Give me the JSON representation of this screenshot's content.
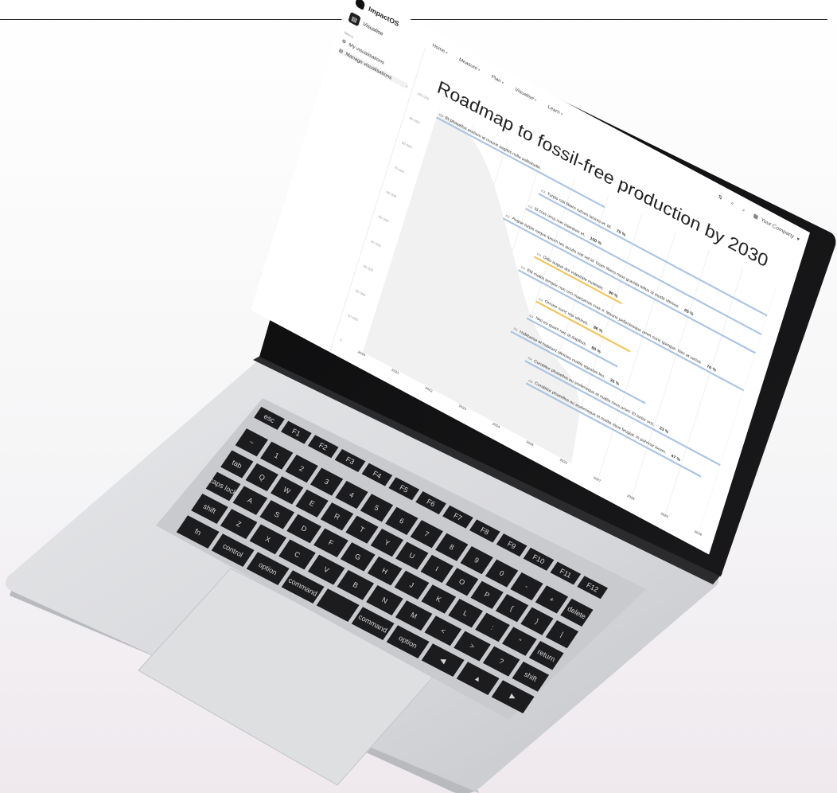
{
  "app": {
    "brand": "ImpactOS",
    "side_button_label": "Visualise",
    "menu_label": "Menu",
    "sidebar_items": [
      {
        "label": "My visualisations",
        "icon": "gear-icon"
      },
      {
        "label": "Manage visualisations",
        "icon": "sliders-icon"
      }
    ],
    "nav_items": [
      "Home",
      "Measure",
      "Plan",
      "Visualise",
      "Learn"
    ],
    "company": "Your Company"
  },
  "chart_data": {
    "type": "gantt",
    "title": "Roadmap to fossil-free production by 2030",
    "x_ticks": [
      "2020",
      "2021",
      "2022",
      "2023",
      "2024",
      "2025",
      "2026",
      "2027",
      "2028",
      "2029",
      "2030"
    ],
    "y_ticks": [
      "100 000",
      "90 000",
      "80 000",
      "70 000",
      "60 000",
      "50 000",
      "40 000",
      "30 000",
      "20 000",
      "10 000",
      "0"
    ],
    "ylim": [
      0,
      100000
    ],
    "tasks": [
      {
        "label": "Et phasellus pretium id mauris sagittis nulla sollicitudin.",
        "percent": "",
        "start": 2020.0,
        "end": 2025.0,
        "color": "#a9c4e3"
      },
      {
        "label": "Turpis nisl libero rutrum lacinia et. Id.",
        "percent": "75 %",
        "start": 2023.2,
        "end": 2030.0,
        "color": "#a9c4e3"
      },
      {
        "label": "Id cras urna non interdum et.",
        "percent": "100 %",
        "start": 2023.0,
        "end": 2030.0,
        "color": "#a9c4e3"
      },
      {
        "label": "Augue turpis neque ipsum leo iaculis nisl vel id. Diam libero risus gravida tellus ut morbi ultrices.",
        "percent": "65 %",
        "start": 2022.5,
        "end": 2030.0,
        "color": "#a9c4e3"
      },
      {
        "label": "Odio augue dui vulputate molestie.",
        "percent": "90 %",
        "start": 2023.6,
        "end": 2026.2,
        "color": "#f2c45a"
      },
      {
        "label": "Elit mattis tempor non orci maecenas cras a. Mauris pellentesque amet nunc quisque. Nec at varius.",
        "percent": "76 %",
        "start": 2023.3,
        "end": 2030.0,
        "color": "#a9c4e3"
      },
      {
        "label": "Ornare nunc nisl ultrices.",
        "percent": "86 %",
        "start": 2024.0,
        "end": 2026.8,
        "color": "#f2c45a"
      },
      {
        "label": "Nisi eu quam nec at dapibus.",
        "percent": "80 %",
        "start": 2023.9,
        "end": 2026.6,
        "color": "#a9c4e3"
      },
      {
        "label": "Habitasse et habitant ultricies mattis egestas leo.",
        "percent": "35 %",
        "start": 2023.6,
        "end": 2027.6,
        "color": "#a9c4e3"
      },
      {
        "label": "Curabitur phasellus eu scelerisque et mattis risus amet. Et tortor orci.",
        "percent": "23 %",
        "start": 2024.2,
        "end": 2030.0,
        "color": "#a9c4e3"
      },
      {
        "label": "Curabitur phasellus eu scelerisque et mattis risus feugiat. In pulvinar lorem.",
        "percent": "47 %",
        "start": 2024.4,
        "end": 2029.6,
        "color": "#a9c4e3"
      }
    ]
  },
  "keyboard": {
    "row1": [
      "esc",
      "F1",
      "F2",
      "F3",
      "F4",
      "F5",
      "F6",
      "F7",
      "F8",
      "F9",
      "F10",
      "F11",
      "F12"
    ],
    "row2": [
      "~",
      "1",
      "2",
      "3",
      "4",
      "5",
      "6",
      "7",
      "8",
      "9",
      "0",
      "-",
      "+",
      "delete"
    ],
    "row3": [
      "tab",
      "Q",
      "W",
      "E",
      "R",
      "T",
      "Y",
      "U",
      "I",
      "O",
      "P",
      "{",
      "}",
      "|"
    ],
    "row4": [
      "caps lock",
      "A",
      "S",
      "D",
      "F",
      "G",
      "H",
      "J",
      "K",
      "L",
      ":",
      "\"",
      "return"
    ],
    "row5": [
      "shift",
      "Z",
      "X",
      "C",
      "V",
      "B",
      "N",
      "M",
      "<",
      ">",
      "?",
      "shift"
    ],
    "row6": [
      "fn",
      "control",
      "option",
      "command",
      "",
      "command",
      "option",
      "◀",
      "▲",
      "▶"
    ]
  },
  "colors": {
    "bar_blue": "#a9c4e3",
    "bar_yellow": "#f2c45a",
    "laptop_silver": "#cfd0d2",
    "key_black": "#1c1c1e"
  }
}
